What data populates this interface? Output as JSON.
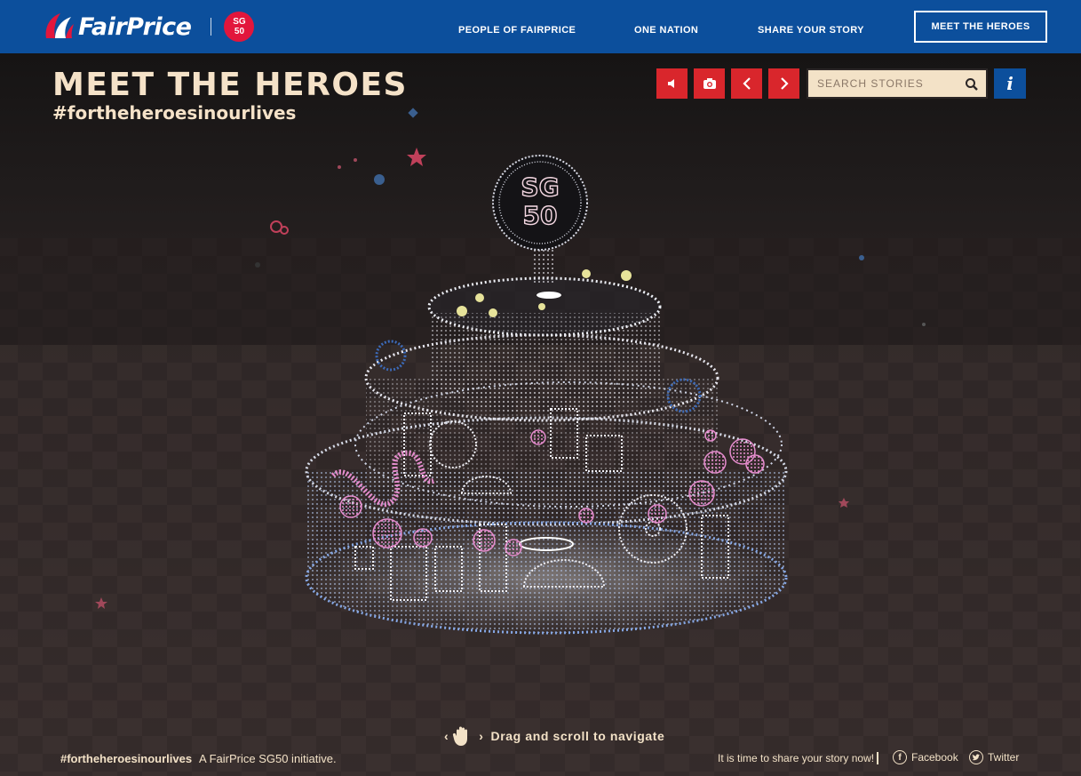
{
  "brand": {
    "name": "FairPrice",
    "partner_badge": "SG\n50"
  },
  "nav": {
    "items": [
      {
        "label": "PEOPLE OF FAIRPRICE"
      },
      {
        "label": "ONE NATION"
      },
      {
        "label": "SHARE YOUR STORY"
      }
    ],
    "cta_label": "MEET THE HEROES"
  },
  "hero": {
    "title": "MEET THE HEROES",
    "hashtag": "#fortheheroesinourlives"
  },
  "toolbar": {
    "sound_icon": "speaker-icon",
    "camera_icon": "camera-icon",
    "prev_icon": "chevron-left-icon",
    "next_icon": "chevron-right-icon",
    "search_placeholder": "SEARCH STORIES",
    "info_label": "i"
  },
  "scene": {
    "topper_text": "SG\n50",
    "hint_text": "Drag and scroll to navigate"
  },
  "footer": {
    "hashtag": "#fortheheroesinourlives",
    "tagline": "A FairPrice SG50 initiative.",
    "share_prompt": "It is time to share your story now!",
    "facebook_label": "Facebook",
    "twitter_label": "Twitter"
  },
  "colors": {
    "nav_blue": "#0c4f9c",
    "accent_red": "#d9262c",
    "cream": "#f3e2c7",
    "badge_red": "#e2163c"
  }
}
